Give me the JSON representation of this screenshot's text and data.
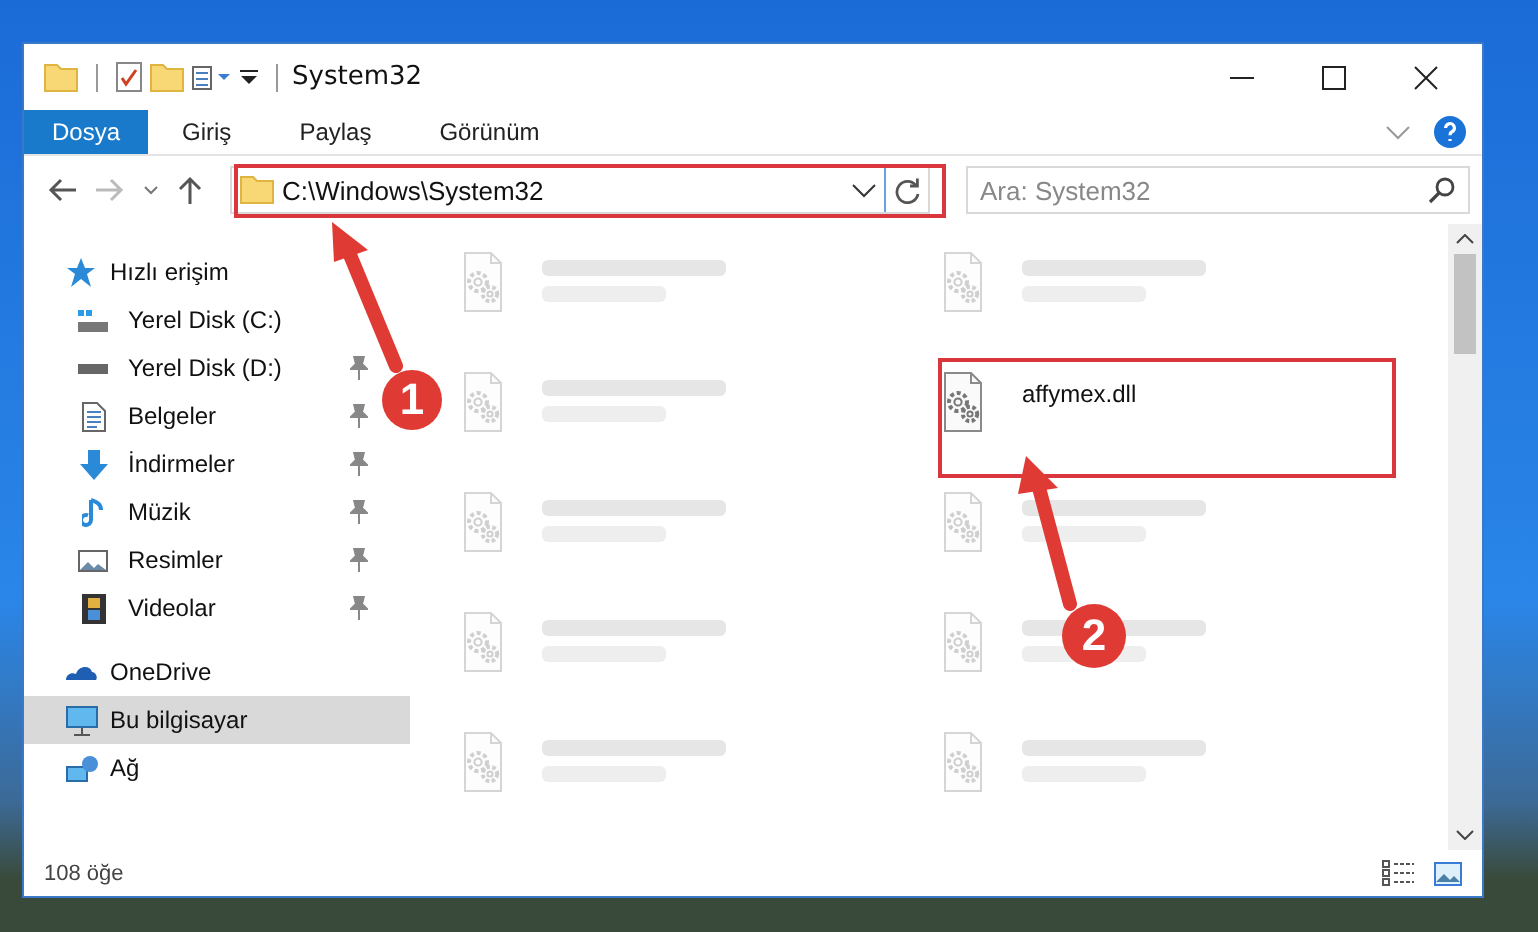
{
  "window": {
    "title": "System32"
  },
  "ribbon_tabs": [
    {
      "label": "Dosya",
      "selected": true
    },
    {
      "label": "Giriş",
      "selected": false
    },
    {
      "label": "Paylaş",
      "selected": false
    },
    {
      "label": "Görünüm",
      "selected": false
    }
  ],
  "address_bar": {
    "value": "C:\\Windows\\System32"
  },
  "search": {
    "placeholder": "Ara: System32"
  },
  "sidebar": {
    "items": [
      {
        "label": "Hızlı erişim",
        "selected": false,
        "children": [
          {
            "label": "Yerel Disk (C:)",
            "pinned": false
          },
          {
            "label": "Yerel Disk (D:)",
            "pinned": true
          },
          {
            "label": "Belgeler",
            "pinned": true
          },
          {
            "label": "İndirmeler",
            "pinned": true
          },
          {
            "label": "Müzik",
            "pinned": true
          },
          {
            "label": "Resimler",
            "pinned": true
          },
          {
            "label": "Videolar",
            "pinned": true
          }
        ]
      },
      {
        "label": "OneDrive",
        "selected": false
      },
      {
        "label": "Bu bilgisayar",
        "selected": true
      },
      {
        "label": "Ağ",
        "selected": false
      }
    ]
  },
  "files": [
    {
      "blurred": true
    },
    {
      "blurred": true
    },
    {
      "blurred": true
    },
    {
      "name": "affymex.dll",
      "blurred": false
    },
    {
      "blurred": true
    },
    {
      "blurred": true
    },
    {
      "blurred": true
    },
    {
      "blurred": true
    },
    {
      "blurred": true
    },
    {
      "blurred": true
    }
  ],
  "status_bar": {
    "item_count": "108 öğe"
  },
  "callouts": [
    {
      "number": "1"
    },
    {
      "number": "2"
    }
  ]
}
